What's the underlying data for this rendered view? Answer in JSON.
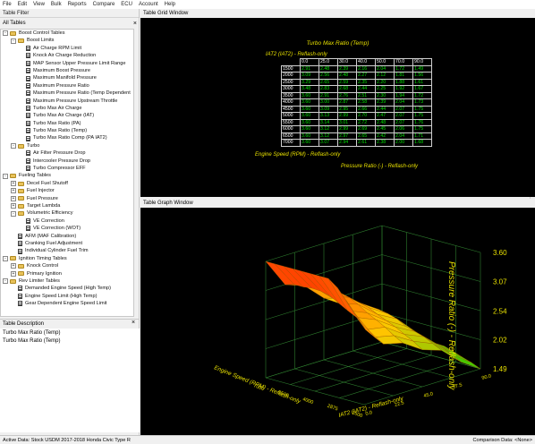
{
  "menu": [
    "File",
    "Edit",
    "View",
    "Bulk",
    "Reports",
    "Compare",
    "ECU",
    "Account",
    "Help"
  ],
  "table_filter": {
    "title": "Table Filter"
  },
  "all_tables": {
    "title": "All Tables",
    "close": "×"
  },
  "tree": [
    {
      "level": 0,
      "expander": "-",
      "kind": "folder",
      "label": "Boost Control Tables"
    },
    {
      "level": 1,
      "expander": "-",
      "kind": "folder",
      "label": "Boost Limits"
    },
    {
      "level": 2,
      "expander": "",
      "kind": "table",
      "label": "Air Charge RPM Limit"
    },
    {
      "level": 2,
      "expander": "",
      "kind": "table",
      "label": "Knock Air Charge Reduction"
    },
    {
      "level": 2,
      "expander": "",
      "kind": "table",
      "label": "MAP Sensor Upper Pressure Limit Range"
    },
    {
      "level": 2,
      "expander": "",
      "kind": "table",
      "label": "Maximum Boost Pressure"
    },
    {
      "level": 2,
      "expander": "",
      "kind": "table",
      "label": "Maximum Manifold Pressure"
    },
    {
      "level": 2,
      "expander": "",
      "kind": "table",
      "label": "Maximum Pressure Ratio"
    },
    {
      "level": 2,
      "expander": "",
      "kind": "table",
      "label": "Maximum Pressure Ratio (Temp Dependent"
    },
    {
      "level": 2,
      "expander": "",
      "kind": "table",
      "label": "Maximum Pressure Upstream Throttle"
    },
    {
      "level": 2,
      "expander": "",
      "kind": "table",
      "label": "Turbo Max Air Charge"
    },
    {
      "level": 2,
      "expander": "",
      "kind": "table",
      "label": "Turbo Max Air Charge (IAT)"
    },
    {
      "level": 2,
      "expander": "",
      "kind": "table",
      "label": "Turbo Max Ratio (PA)"
    },
    {
      "level": 2,
      "expander": "",
      "kind": "table",
      "label": "Turbo Max Ratio (Temp)"
    },
    {
      "level": 2,
      "expander": "",
      "kind": "table",
      "label": "Turbo Max Ratio Comp (PA IAT2)"
    },
    {
      "level": 1,
      "expander": "-",
      "kind": "folder",
      "label": "Turbo"
    },
    {
      "level": 2,
      "expander": "",
      "kind": "table",
      "label": "Air Filter Pressure Drop"
    },
    {
      "level": 2,
      "expander": "",
      "kind": "table",
      "label": "Intercooler Pressure Drop"
    },
    {
      "level": 2,
      "expander": "",
      "kind": "table",
      "label": "Turbo Compressor EFF"
    },
    {
      "level": 0,
      "expander": "-",
      "kind": "folder",
      "label": "Fueling Tables"
    },
    {
      "level": 1,
      "expander": "+",
      "kind": "folder",
      "label": "Decel Fuel Shutoff"
    },
    {
      "level": 1,
      "expander": "+",
      "kind": "folder",
      "label": "Fuel Injector"
    },
    {
      "level": 1,
      "expander": "+",
      "kind": "folder",
      "label": "Fuel Pressure"
    },
    {
      "level": 1,
      "expander": "+",
      "kind": "folder",
      "label": "Target Lambda"
    },
    {
      "level": 1,
      "expander": "-",
      "kind": "folder",
      "label": "Volumetric Efficiency"
    },
    {
      "level": 2,
      "expander": "",
      "kind": "table",
      "label": "VE Correction"
    },
    {
      "level": 2,
      "expander": "",
      "kind": "table",
      "label": "VE Correction (WOT)"
    },
    {
      "level": 1,
      "expander": "",
      "kind": "table",
      "label": "AFM (MAF Calibration)"
    },
    {
      "level": 1,
      "expander": "",
      "kind": "table",
      "label": "Cranking Fuel Adjustment"
    },
    {
      "level": 1,
      "expander": "",
      "kind": "table",
      "label": "Individual Cylinder Fuel Trim"
    },
    {
      "level": 0,
      "expander": "-",
      "kind": "folder",
      "label": "Ignition Timing Tables"
    },
    {
      "level": 1,
      "expander": "+",
      "kind": "folder",
      "label": "Knock Control"
    },
    {
      "level": 1,
      "expander": "+",
      "kind": "folder",
      "label": "Primary Ignition"
    },
    {
      "level": 0,
      "expander": "-",
      "kind": "folder",
      "label": "Rev Limiter Tables"
    },
    {
      "level": 1,
      "expander": "",
      "kind": "table",
      "label": "Demanded Engine Speed (High Temp)"
    },
    {
      "level": 1,
      "expander": "",
      "kind": "table",
      "label": "Engine Speed Limit (High Temp)"
    },
    {
      "level": 1,
      "expander": "",
      "kind": "table",
      "label": "Gear Dependent Engine Speed Limit"
    }
  ],
  "description": {
    "title": "Table Description",
    "close": "×",
    "lines": [
      "Turbo Max Ratio (Temp)",
      "Turbo Max Ratio (Temp)"
    ]
  },
  "grid_window": {
    "title": "Table Grid Window",
    "table_name": "Turbo Max Ratio (Temp)",
    "col_axis": "IAT2 (IAT2) - Reflash-only",
    "row_axis": "Engine Speed (RPM) - Reflash-only",
    "value_axis": "Pressure Ratio (-) - Reflash-only",
    "col_headers": [
      "0.0",
      "25.0",
      "30.0",
      "40.0",
      "50.0",
      "70.0",
      "90.0"
    ],
    "rows": [
      {
        "rpm": "1500",
        "vals": [
          "2.91",
          "2.48",
          "2.39",
          "2.16",
          "2.04",
          "1.72",
          "1.49"
        ]
      },
      {
        "rpm": "2000",
        "vals": [
          "3.09",
          "2.56",
          "2.48",
          "2.27",
          "2.12",
          "1.81",
          "1.56"
        ]
      },
      {
        "rpm": "2500",
        "vals": [
          "3.29",
          "2.65",
          "2.59",
          "2.35",
          "2.20",
          "1.88",
          "1.61"
        ]
      },
      {
        "rpm": "3000",
        "vals": [
          "3.48",
          "2.83",
          "2.68",
          "2.44",
          "2.25",
          "1.92",
          "1.67"
        ]
      },
      {
        "rpm": "3500",
        "vals": [
          "3.60",
          "2.91",
          "2.76",
          "2.51",
          "2.30",
          "1.94",
          "1.72"
        ]
      },
      {
        "rpm": "4000",
        "vals": [
          "3.60",
          "3.00",
          "2.87",
          "2.58",
          "2.39",
          "2.04",
          "1.73"
        ]
      },
      {
        "rpm": "4500",
        "vals": [
          "3.60",
          "3.09",
          "2.95",
          "2.66",
          "2.44",
          "2.07",
          "1.75"
        ]
      },
      {
        "rpm": "5000",
        "vals": [
          "3.60",
          "3.13",
          "2.99",
          "2.70",
          "2.47",
          "2.07",
          "1.75"
        ]
      },
      {
        "rpm": "5500",
        "vals": [
          "3.60",
          "3.14",
          "3.01",
          "2.72",
          "2.48",
          "2.07",
          "1.76"
        ]
      },
      {
        "rpm": "6000",
        "vals": [
          "3.60",
          "3.12",
          "2.99",
          "2.69",
          "2.45",
          "2.06",
          "1.75"
        ]
      },
      {
        "rpm": "6500",
        "vals": [
          "3.60",
          "3.12",
          "2.97",
          "2.65",
          "2.42",
          "2.04",
          "1.71"
        ]
      },
      {
        "rpm": "7000",
        "vals": [
          "3.60",
          "3.07",
          "2.94",
          "2.61",
          "2.38",
          "2.00",
          "1.68"
        ]
      }
    ]
  },
  "graph_window": {
    "title": "Table Graph Window",
    "z_axis_label": "Pressure Ratio (-) - Reflash-only",
    "z_ticks": [
      "3.60",
      "3.07",
      "2.54",
      "2.02",
      "1.49"
    ],
    "rpm_axis_label": "Engine Speed (RPM) - Reflash-only",
    "rpm_ticks": [
      "7000",
      "5500",
      "4000",
      "2875",
      "1500"
    ],
    "iat_axis_label": "IAT2 (IAT2) - Reflash-only",
    "iat_ticks": [
      "90.0",
      "67.5",
      "45.0",
      "22.5",
      "0.0"
    ]
  },
  "status": {
    "left": "Active Data: Stock USDM 2017-2018 Honda Civic Type R",
    "right": "Comparison Data: <None>"
  }
}
